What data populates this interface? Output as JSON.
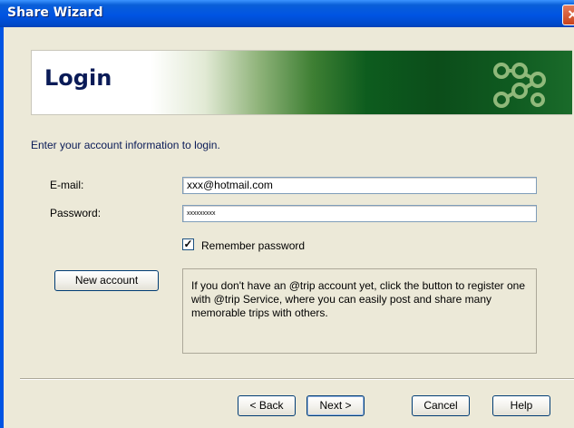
{
  "window": {
    "title": "Share Wizard",
    "close_glyph": "✕"
  },
  "banner": {
    "title": "Login",
    "logo_icon": "trip-network-logo-icon"
  },
  "intro_text": "Enter your account information to login.",
  "form": {
    "email_label": "E-mail:",
    "email_value": "xxx@hotmail.com",
    "password_label": "Password:",
    "password_value": "xxxxxxxxx",
    "remember_label": "Remember password",
    "remember_checked": true,
    "check_glyph": "✓"
  },
  "new_account_button": "New account",
  "info_text": "If you don't have an @trip account yet, click the button to register one with @trip Service, where you can easily post and share many memorable trips with others.",
  "footer": {
    "back_label": "< Back",
    "next_label": "Next >",
    "cancel_label": "Cancel",
    "help_label": "Help"
  },
  "colors": {
    "titlebar": "#0054e3",
    "banner_green": "#0c4d1a",
    "heading": "#0a1b57"
  }
}
